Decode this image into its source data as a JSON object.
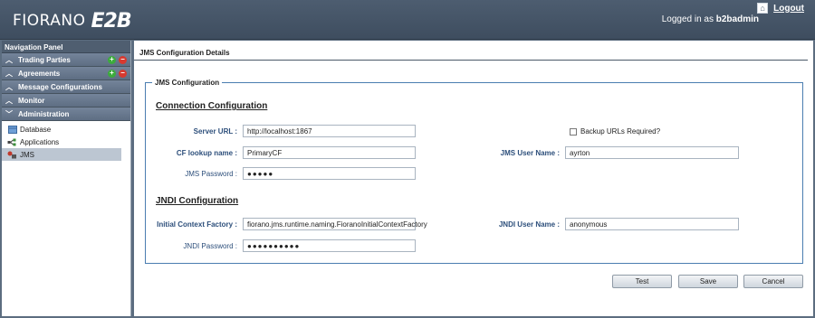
{
  "header": {
    "logo_text": "FIORANO",
    "logo_mark": "E2B",
    "logged_in_prefix": "Logged in as ",
    "username": "b2badmin",
    "logout_label": "Logout"
  },
  "nav": {
    "title": "Navigation Panel",
    "sections": [
      {
        "label": "Trading Parties",
        "chevron": "^",
        "has_actions": true
      },
      {
        "label": "Agreements",
        "chevron": "^",
        "has_actions": true
      },
      {
        "label": "Message Configurations",
        "chevron": "^",
        "has_actions": false
      },
      {
        "label": "Monitor",
        "chevron": "^",
        "has_actions": false
      },
      {
        "label": "Administration",
        "chevron": "v",
        "has_actions": false
      }
    ],
    "items": [
      {
        "label": "Database",
        "icon": "database-icon"
      },
      {
        "label": "Applications",
        "icon": "applications-icon"
      },
      {
        "label": "JMS",
        "icon": "jms-icon",
        "active": true
      }
    ]
  },
  "main": {
    "title": "JMS Configuration Details",
    "fieldset_legend": "JMS Configuration",
    "connection": {
      "heading": "Connection Configuration",
      "server_url_label": "Server URL :",
      "server_url_value": "http://localhost:1867",
      "backup_label": "Backup URLs Required?",
      "cf_lookup_label": "CF lookup name :",
      "cf_lookup_value": "PrimaryCF",
      "jms_user_label": "JMS User Name :",
      "jms_user_value": "ayrton",
      "jms_password_label": "JMS Password :",
      "jms_password_value": "●●●●●"
    },
    "jndi": {
      "heading": "JNDI Configuration",
      "icf_label": "Initial Context Factory :",
      "icf_value": "fiorano.jms.runtime.naming.FioranoInitialContextFactory",
      "jndi_user_label": "JNDI User Name :",
      "jndi_user_value": "anonymous",
      "jndi_password_label": "JNDI Password :",
      "jndi_password_value": "●●●●●●●●●●"
    },
    "buttons": {
      "test": "Test",
      "save": "Save",
      "cancel": "Cancel"
    }
  }
}
